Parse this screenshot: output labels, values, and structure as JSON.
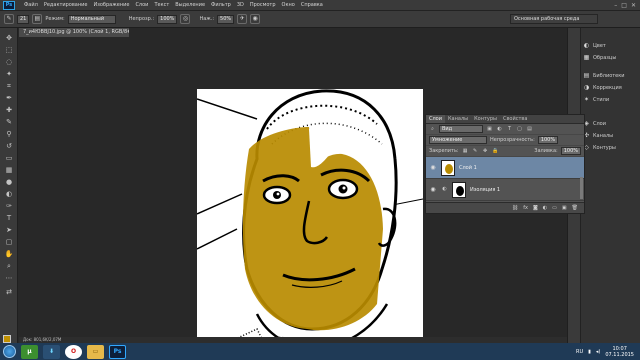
{
  "menu": {
    "logo": "Ps",
    "items": [
      "Файл",
      "Редактирование",
      "Изображение",
      "Слои",
      "Текст",
      "Выделение",
      "Фильтр",
      "3D",
      "Просмотр",
      "Окно",
      "Справка"
    ]
  },
  "options": {
    "brush_size": "21",
    "mode_label": "Режим:",
    "mode_value": "Нормальный",
    "opacity_label": "Непрозр.:",
    "opacity_value": "100%",
    "pressure_label": "Наж.:",
    "pressure_value": "50%",
    "workspace": "Основная рабочая среда"
  },
  "document": {
    "tab_title": "7_и4ЮВВЈ10.jpg @ 100% (Слой 1, RGB/8#) *",
    "status": "Док: 801,6K/2,07M"
  },
  "dock": {
    "items": [
      "Цвет",
      "Образцы",
      "Библиотеки",
      "Коррекция",
      "Стили",
      "Слои",
      "Каналы",
      "Контуры"
    ]
  },
  "layers_panel": {
    "tabs": [
      "Слои",
      "Каналы",
      "Контуры",
      "Свойства"
    ],
    "filter_label": "Вид",
    "blend_mode": "Умножение",
    "opacity_label": "Непрозрачность:",
    "opacity_value": "100%",
    "lock_label": "Закрепить:",
    "fill_label": "Заливка:",
    "fill_value": "100%",
    "layers": [
      {
        "name": "Слой 1",
        "selected": true
      },
      {
        "name": "Изоляция 1",
        "selected": false
      }
    ]
  },
  "taskbar": {
    "apps": [
      "uTorrent",
      "Opera",
      "Explorer",
      "Photoshop"
    ],
    "language": "RU",
    "time": "10:07",
    "date": "07.11.2015"
  },
  "colors": {
    "foreground": "#c09000",
    "background": "#ffffff",
    "paint_overlay": "#b88b00"
  }
}
